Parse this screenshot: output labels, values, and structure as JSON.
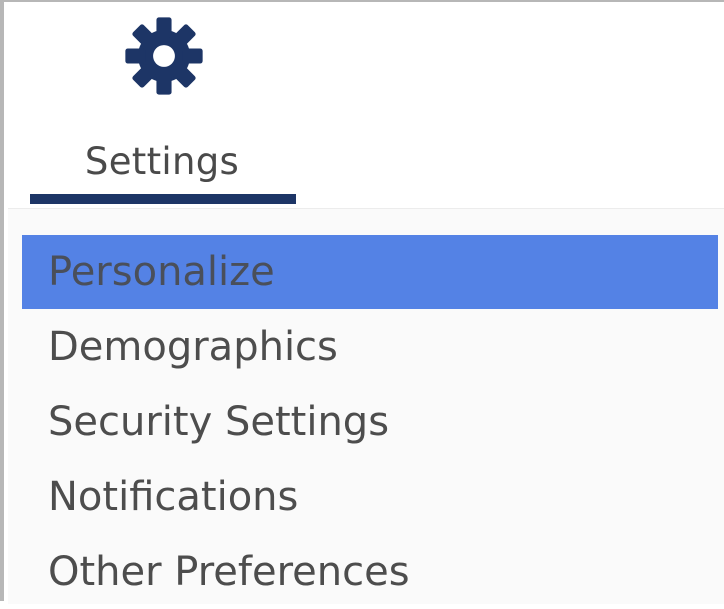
{
  "tab": {
    "icon": "gear-icon",
    "label": "Settings",
    "icon_color": "#1d3566",
    "underline_color": "#1d3566"
  },
  "menu": {
    "active_color": "#5482e5",
    "items": [
      {
        "label": "Personalize",
        "active": true
      },
      {
        "label": "Demographics",
        "active": false
      },
      {
        "label": "Security Settings",
        "active": false
      },
      {
        "label": "Notifications",
        "active": false
      },
      {
        "label": "Other Preferences",
        "active": false
      }
    ]
  }
}
